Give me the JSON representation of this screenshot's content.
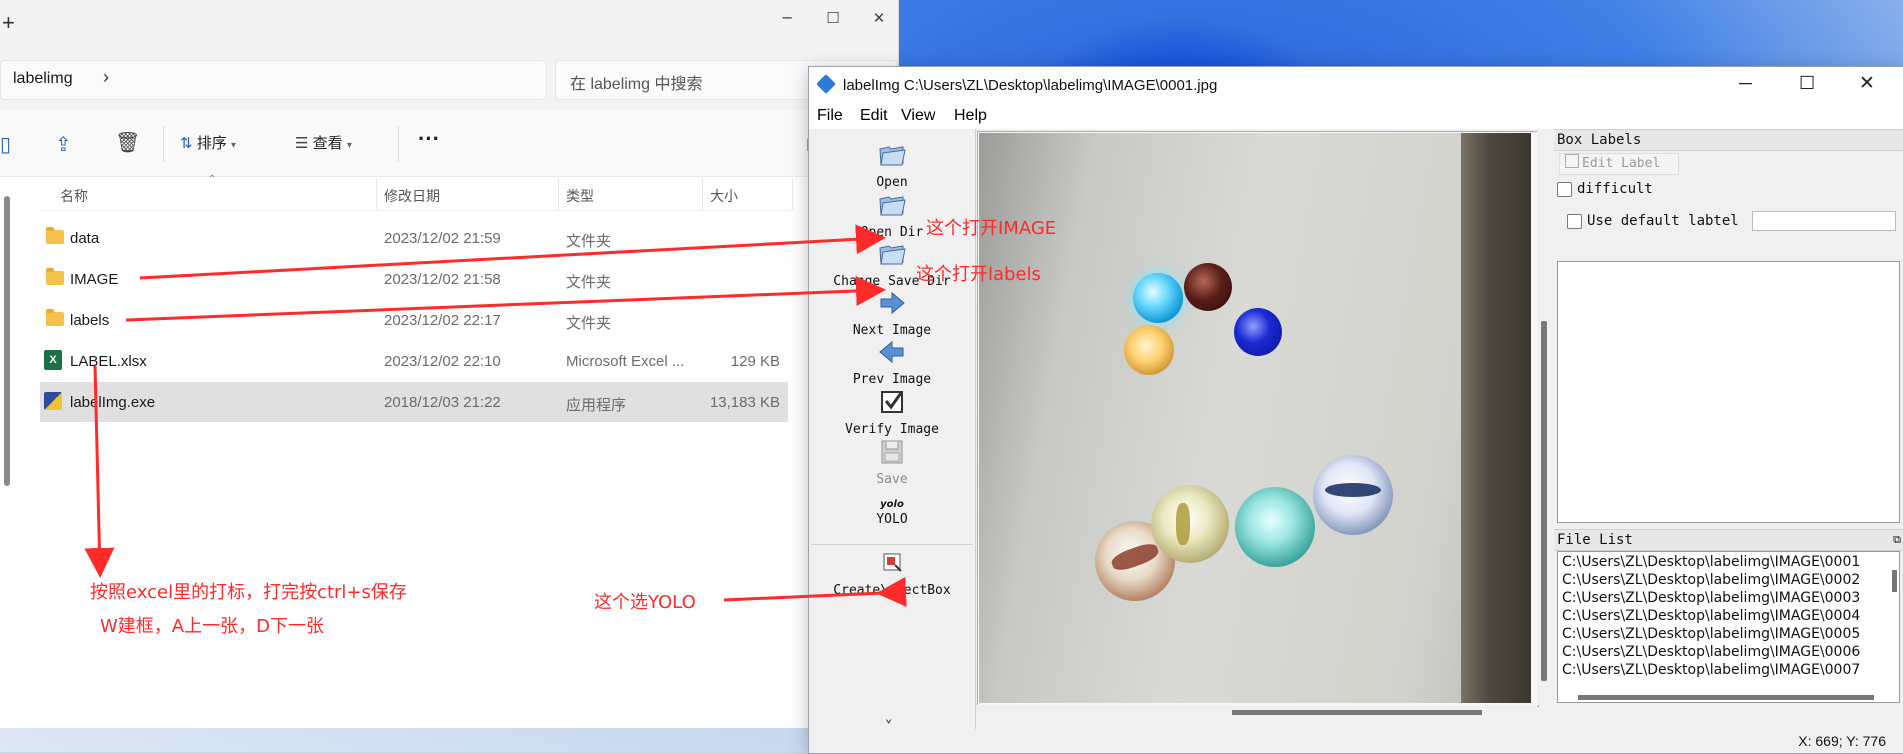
{
  "explorer": {
    "new_tab_label": "+",
    "minimize": "─",
    "maximize": "☐",
    "close": "✕",
    "breadcrumb": "labelimg",
    "breadcrumb_chevron": "›",
    "search_placeholder": "在 labelimg 中搜索",
    "toolbar": {
      "sort_label": "排序",
      "view_label": "查看",
      "more_label": "···",
      "details_label": "详"
    },
    "columns": {
      "name": "名称",
      "date": "修改日期",
      "type": "类型",
      "size": "大小"
    },
    "files": [
      {
        "name": "data",
        "date": "2023/12/02 21:59",
        "type": "文件夹",
        "size": ""
      },
      {
        "name": "IMAGE",
        "date": "2023/12/02 21:58",
        "type": "文件夹",
        "size": ""
      },
      {
        "name": "labels",
        "date": "2023/12/02 22:17",
        "type": "文件夹",
        "size": ""
      },
      {
        "name": "LABEL.xlsx",
        "date": "2023/12/02 22:10",
        "type": "Microsoft Excel ...",
        "size": "129 KB"
      },
      {
        "name": "labelImg.exe",
        "date": "2018/12/03 21:22",
        "type": "应用程序",
        "size": "13,183 KB"
      }
    ]
  },
  "labelimg": {
    "title": "labelImg C:\\Users\\ZL\\Desktop\\labelimg\\IMAGE\\0001.jpg",
    "menu": [
      "File",
      "Edit",
      "View",
      "Help"
    ],
    "tools": {
      "open": "Open",
      "open_dir": "Open Dir",
      "change_save_dir": "Change Save Dir",
      "next_image": "Next Image",
      "prev_image": "Prev Image",
      "verify_image": "Verify Image",
      "save": "Save",
      "format_icon_text": "yolo",
      "format": "YOLO",
      "create_rectbox": "Create\\nRectBox",
      "more": "⌄"
    },
    "box_labels": {
      "title": "Box Labels",
      "edit_label": "Edit Label",
      "difficult": "difficult",
      "use_default_label": "Use default labtel"
    },
    "file_list": {
      "title": "File List",
      "items": [
        "C:\\Users\\ZL\\Desktop\\labelimg\\IMAGE\\0001",
        "C:\\Users\\ZL\\Desktop\\labelimg\\IMAGE\\0002",
        "C:\\Users\\ZL\\Desktop\\labelimg\\IMAGE\\0003",
        "C:\\Users\\ZL\\Desktop\\labelimg\\IMAGE\\0004",
        "C:\\Users\\ZL\\Desktop\\labelimg\\IMAGE\\0005",
        "C:\\Users\\ZL\\Desktop\\labelimg\\IMAGE\\0006",
        "C:\\Users\\ZL\\Desktop\\labelimg\\IMAGE\\0007"
      ]
    },
    "status": "X: 669; Y: 776"
  },
  "annotations": {
    "open_image_note": "这个打开IMAGE",
    "open_labels_note": "这个打开labels",
    "yolo_note": "这个选YOLO",
    "instruction_line1": "按照excel里的打标，打完按ctrl+s保存",
    "instruction_line2": "W建框，A上一张，D下一张",
    "color": "#ff2a2a"
  }
}
